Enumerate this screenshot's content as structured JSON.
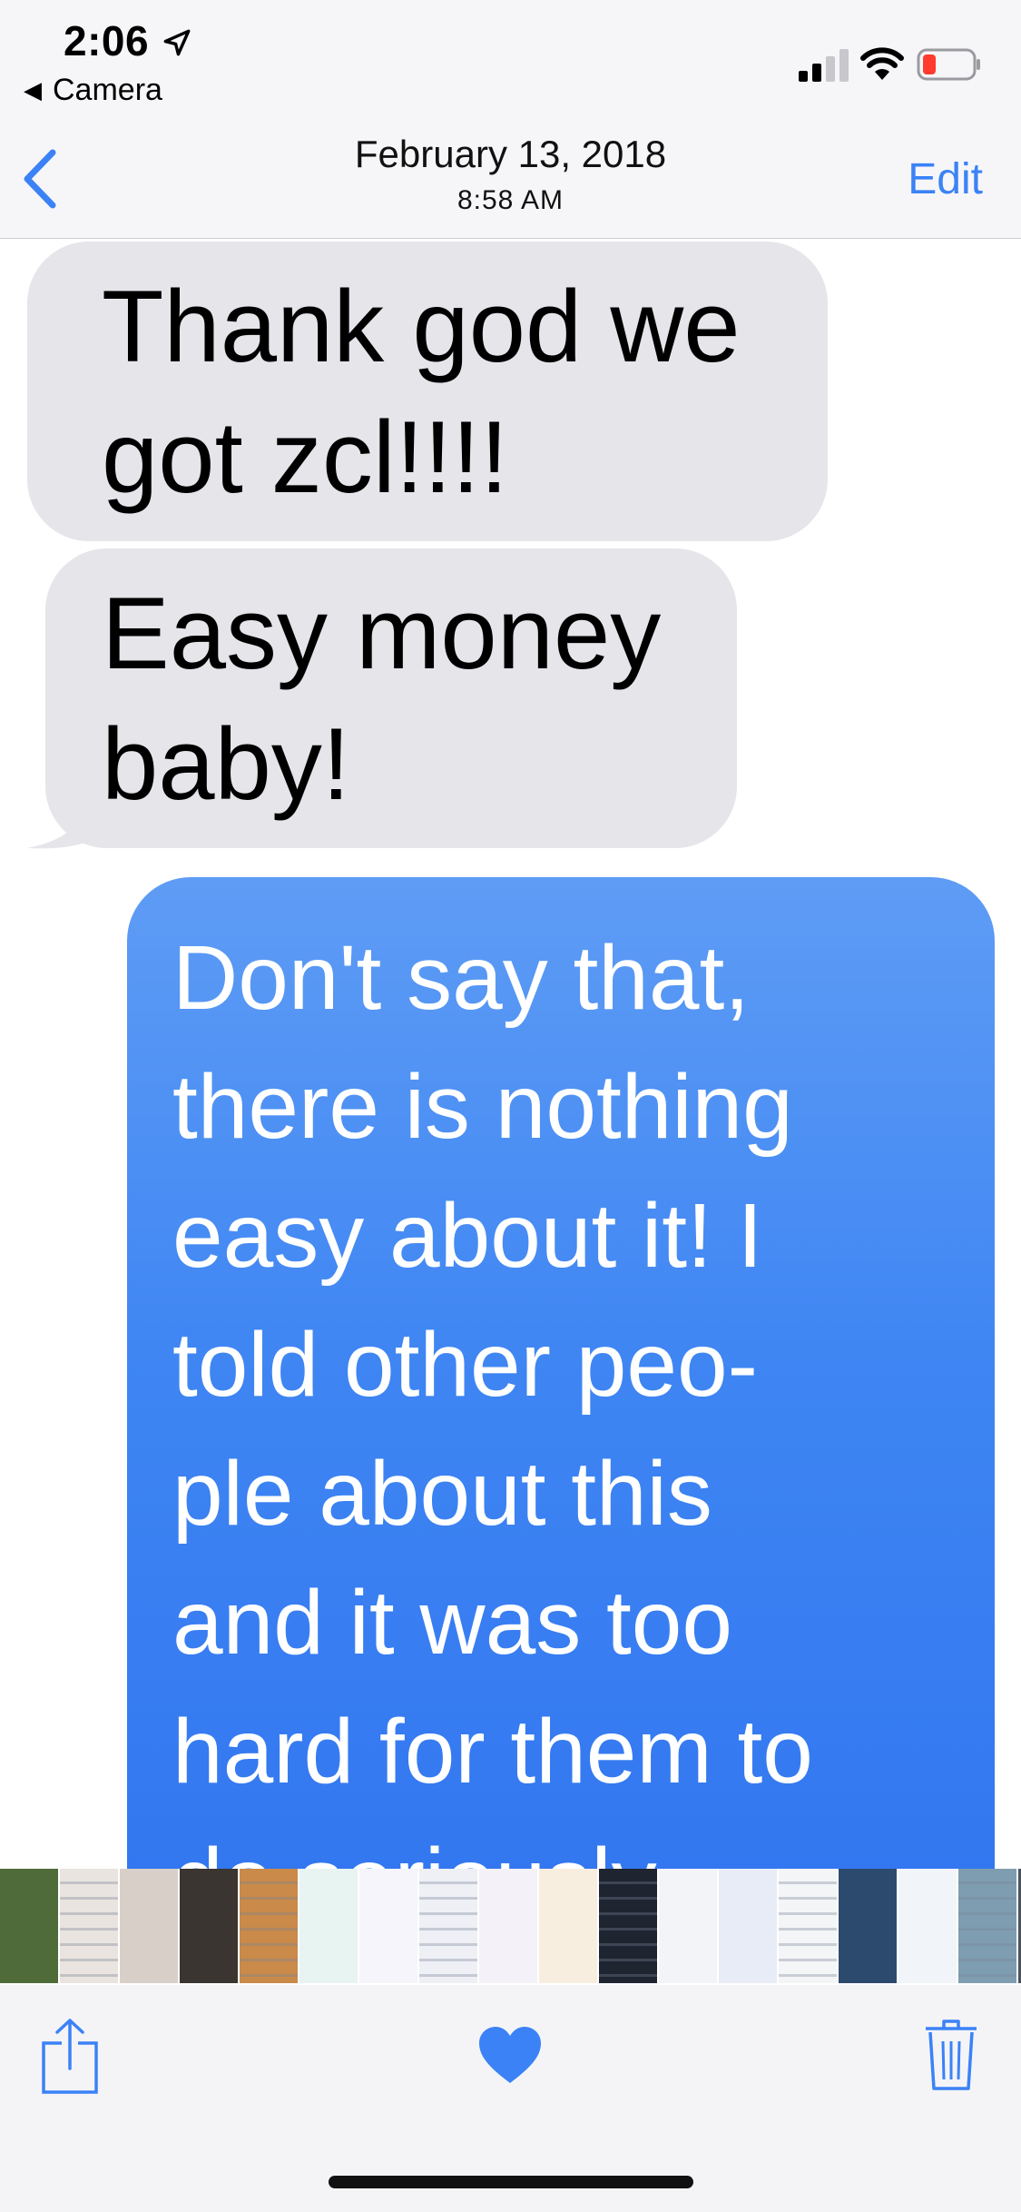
{
  "status_bar": {
    "time": "2:06",
    "back_app": "Camera",
    "battery_color": "#ff3b30"
  },
  "nav": {
    "date": "February 13, 2018",
    "time": "8:58 AM",
    "edit_label": "Edit",
    "accent": "#3b82f6"
  },
  "messages": {
    "incoming": [
      {
        "lines": [
          "Thank god we",
          "got zcl!!!!"
        ]
      },
      {
        "lines": [
          "Easy money",
          "baby!"
        ]
      }
    ],
    "outgoing": {
      "lines": [
        "Don't say that,",
        "there is nothing",
        "easy about it! I",
        "told other peo-",
        "ple about this",
        "and it was too",
        "hard for them to",
        "do seriously"
      ]
    }
  },
  "toolbar": {
    "icons": [
      "share-icon",
      "heart-icon",
      "trash-icon"
    ],
    "favorite_color": "#3b82f6"
  },
  "photo_strip": {
    "thumbs": [
      "#4f6b3a",
      "#e9e4df",
      "#d8d0c8",
      "#3a3530",
      "#c98a4a",
      "#e7f4f2",
      "#f5f5fb",
      "#eef0f6",
      "#f4f2f8",
      "#f7eee0",
      "#1e2430",
      "#f2f4f8",
      "#e7ecf7",
      "#f4f5f7",
      "#2c4a6e",
      "#f1f4f8",
      "#7f9db0",
      "#4a5560",
      "#b7b8b2",
      "#f3f3f5",
      "#eef0f3",
      "#f5f5f7",
      "#f6f4f2"
    ]
  }
}
